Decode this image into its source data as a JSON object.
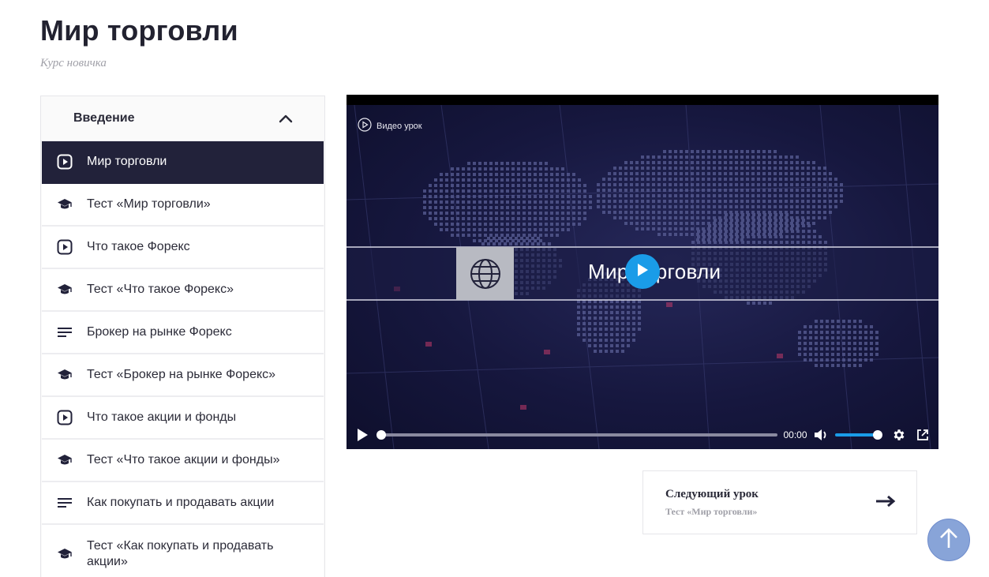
{
  "page": {
    "title": "Мир торговли",
    "subtitle": "Курс новичка"
  },
  "sidebar": {
    "section_title": "Введение",
    "lessons": [
      {
        "label": "Мир торговли",
        "icon": "play-square-icon",
        "active": true
      },
      {
        "label": "Тест «Мир торговли»",
        "icon": "graduation-cap-icon"
      },
      {
        "label": "Что такое Форекс",
        "icon": "play-square-icon"
      },
      {
        "label": "Тест «Что такое Форекс»",
        "icon": "graduation-cap-icon"
      },
      {
        "label": "Брокер на рынке Форекс",
        "icon": "text-lines-icon"
      },
      {
        "label": "Тест «Брокер на рынке Форекс»",
        "icon": "graduation-cap-icon"
      },
      {
        "label": "Что такое акции и фонды",
        "icon": "play-square-icon"
      },
      {
        "label": "Тест «Что такое акции и фонды»",
        "icon": "graduation-cap-icon"
      },
      {
        "label": "Как покупать и продавать акции",
        "icon": "text-lines-icon"
      },
      {
        "label": "Тест «Как покупать и продавать акции»",
        "icon": "graduation-cap-icon"
      }
    ]
  },
  "video": {
    "badge": "Видео урок",
    "banner_text": "Мир торговли",
    "time": "00:00",
    "progress": 0,
    "volume": 1,
    "accent_color": "#1a9ce8"
  },
  "next_lesson": {
    "title": "Следующий урок",
    "subtitle": "Тест «Мир торговли»"
  },
  "colors": {
    "active_item_bg": "#22223a",
    "scroll_top_bg": "#88a4d8"
  }
}
